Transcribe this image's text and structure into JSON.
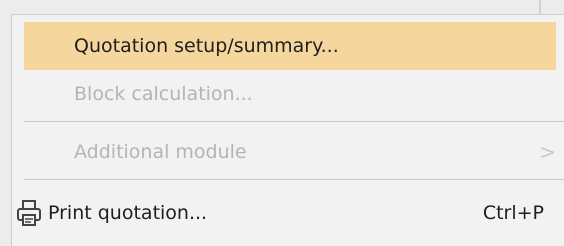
{
  "menu": {
    "items": [
      {
        "label": "Quotation setup/summary...",
        "state": "highlighted"
      },
      {
        "label": "Block calculation...",
        "state": "disabled"
      },
      {
        "label": "Additional module",
        "state": "disabled",
        "submenu_indicator": ">"
      },
      {
        "label": "Print quotation...",
        "state": "enabled",
        "shortcut": "Ctrl+P",
        "icon": "printer-icon"
      }
    ]
  },
  "colors": {
    "highlight": "#f5d79e",
    "menu_bg": "#f2f2f2",
    "disabled_text": "#b4b4b4",
    "text": "#1e1e1e",
    "separator": "#c8c8c8"
  }
}
